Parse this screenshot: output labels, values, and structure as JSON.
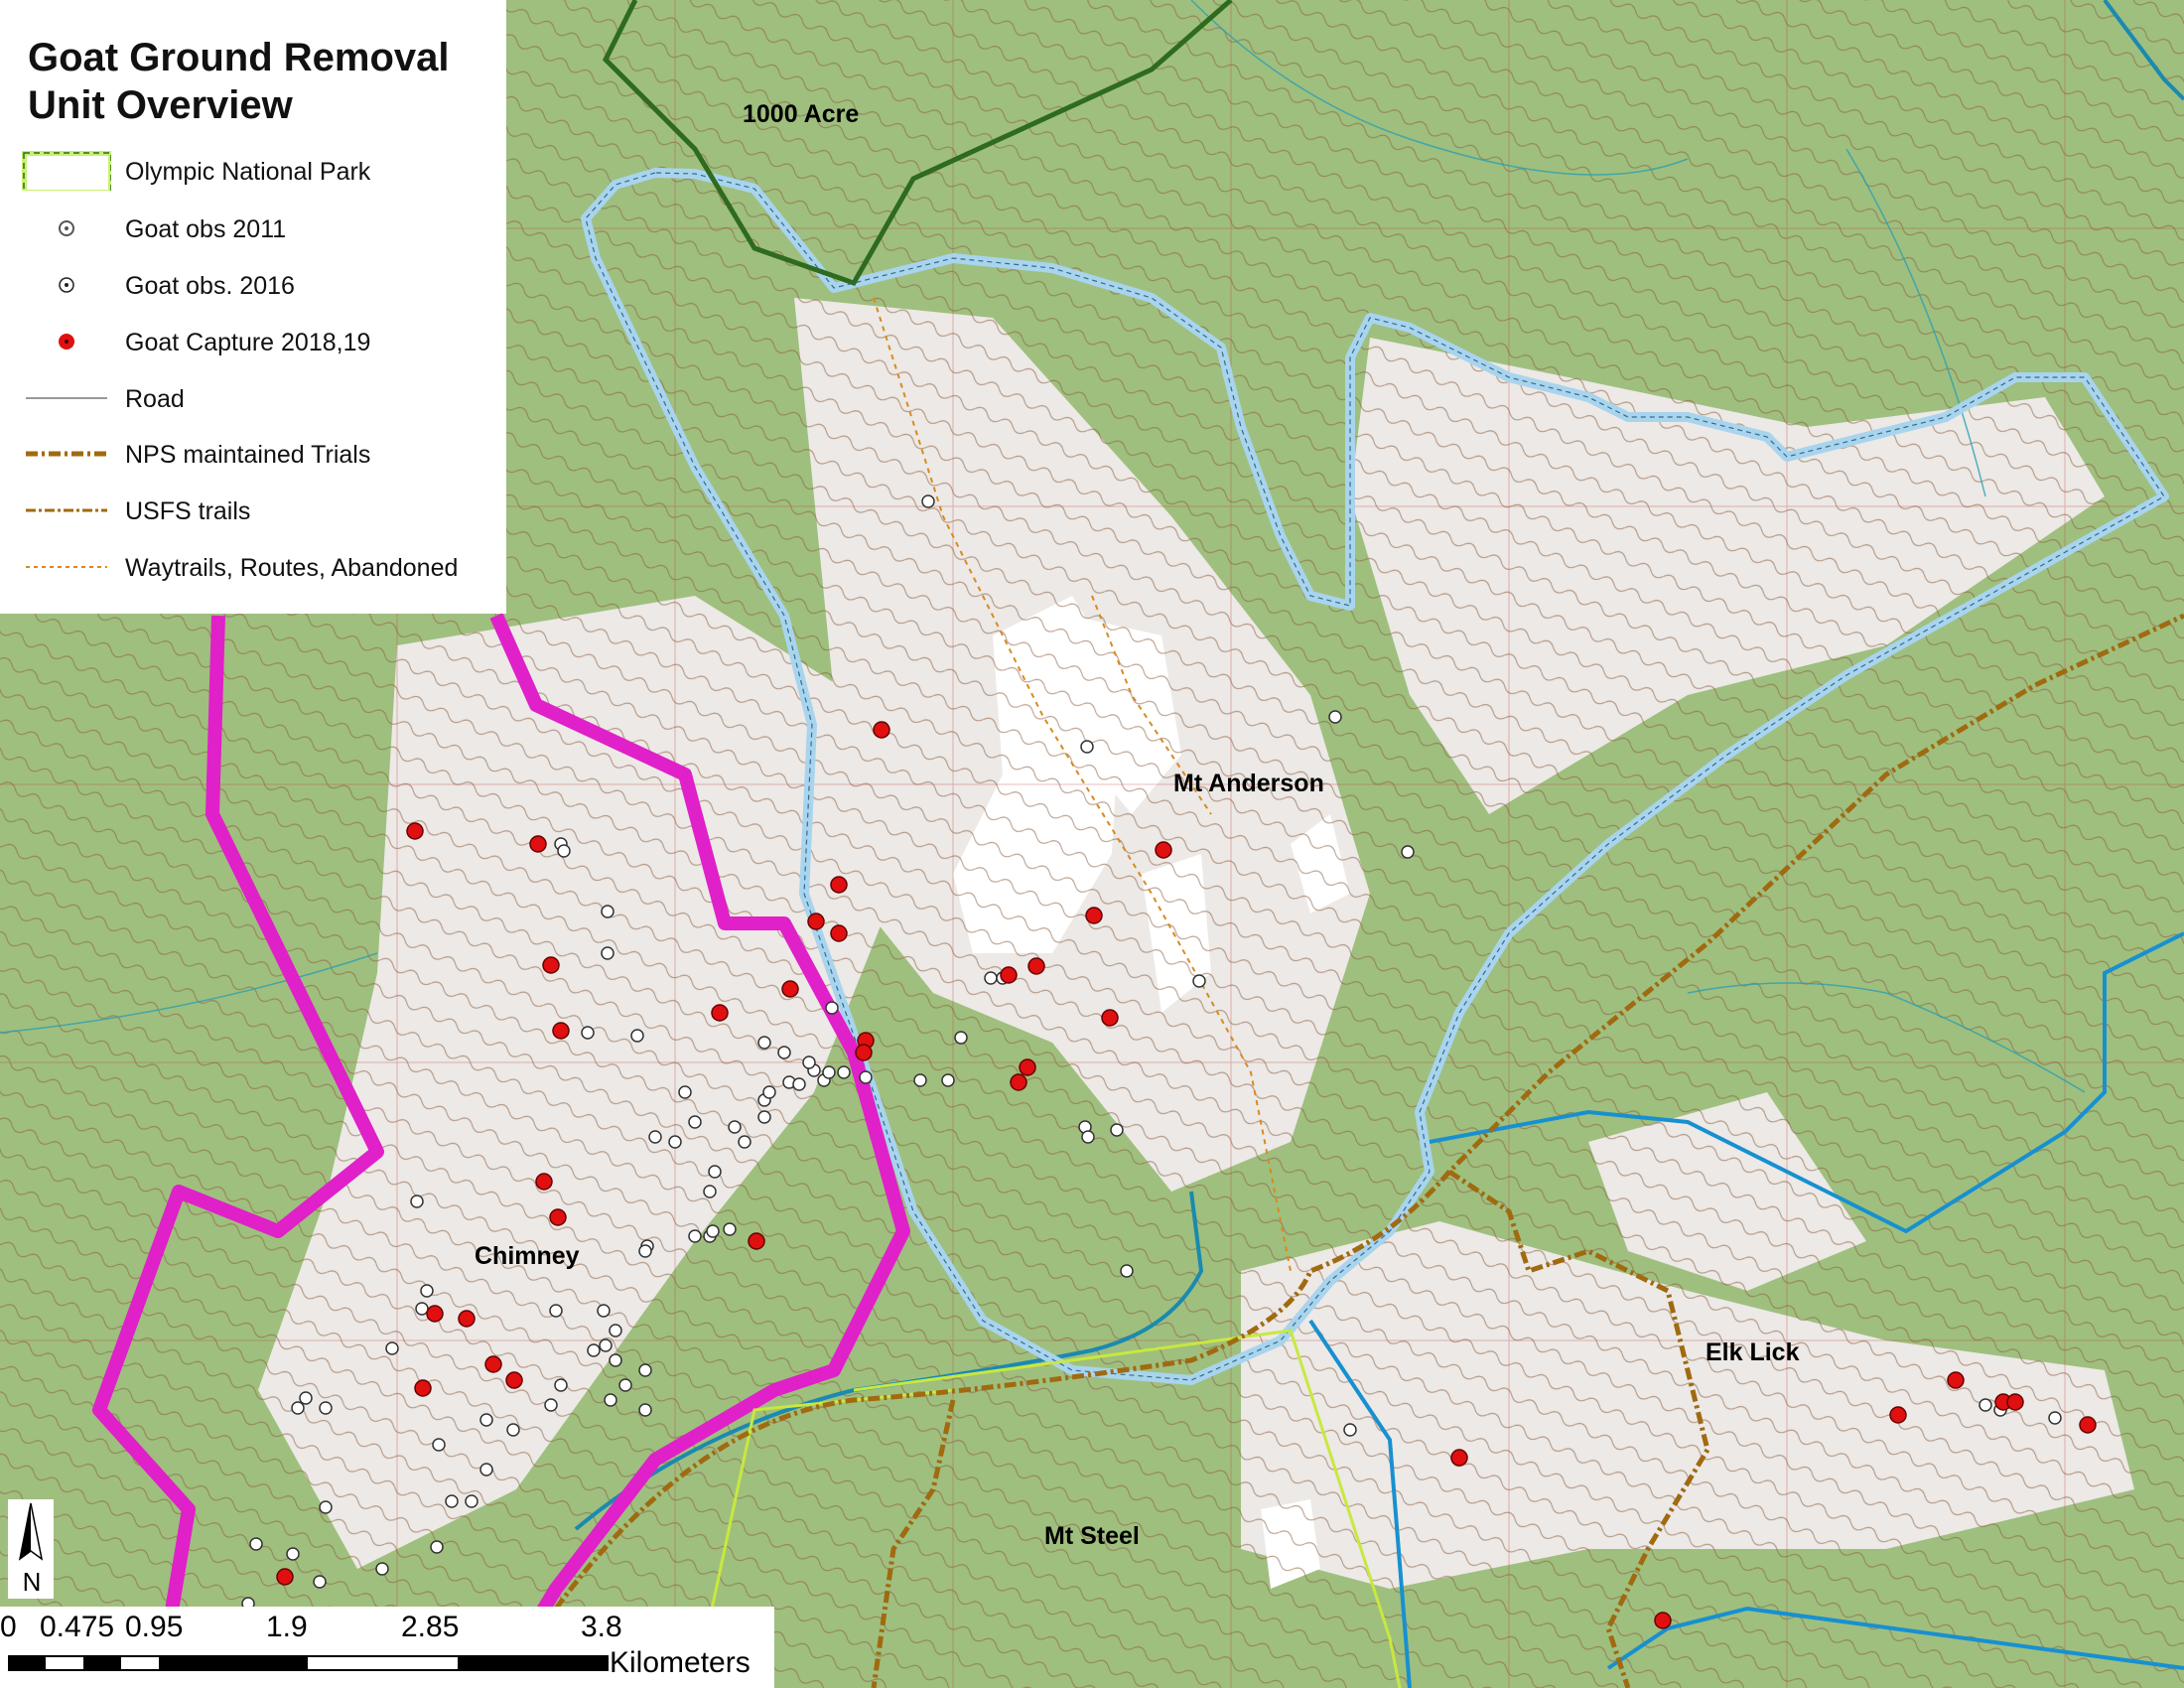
{
  "legend": {
    "title": "Goat Ground Removal Unit Overview",
    "items": [
      {
        "label": "Olympic National Park",
        "symbol": "park-boundary-icon"
      },
      {
        "label": "Goat obs 2011",
        "symbol": "goat-obs-2011-icon"
      },
      {
        "label": "Goat obs. 2016",
        "symbol": "goat-obs-2016-icon"
      },
      {
        "label": "Goat Capture 2018,19",
        "symbol": "goat-capture-icon"
      },
      {
        "label": "Road",
        "symbol": "road-icon"
      },
      {
        "label": "NPS maintained Trials",
        "symbol": "nps-trail-icon"
      },
      {
        "label": "USFS trails",
        "symbol": "usfs-trail-icon"
      },
      {
        "label": "Waytrails, Routes, Abandoned",
        "symbol": "waytrail-icon"
      }
    ]
  },
  "places": {
    "thousand_acre": "1000 Acre",
    "mt_anderson": "Mt Anderson",
    "chimney": "Chimney",
    "elk_lick": "Elk Lick",
    "mt_steel": "Mt Steel"
  },
  "scale": {
    "ticks": [
      "0",
      "0.475",
      "0.95",
      "1.9",
      "2.85",
      "3.8"
    ],
    "units": "Kilometers"
  },
  "north_arrow": {
    "label": "N"
  },
  "colors": {
    "background_green": "#9fbf7e",
    "alpine_white": "#f2f2f2",
    "contour_brown": "#8a5a3c",
    "unit_boundary_blue": "#a8d4ee",
    "park_boundary_magenta": "#e020c8",
    "boundary_dark_green": "#2e6b1e",
    "goat_capture_red": "#e01010",
    "trail_brown": "#a06a10",
    "river_blue": "#1a8ab0"
  }
}
